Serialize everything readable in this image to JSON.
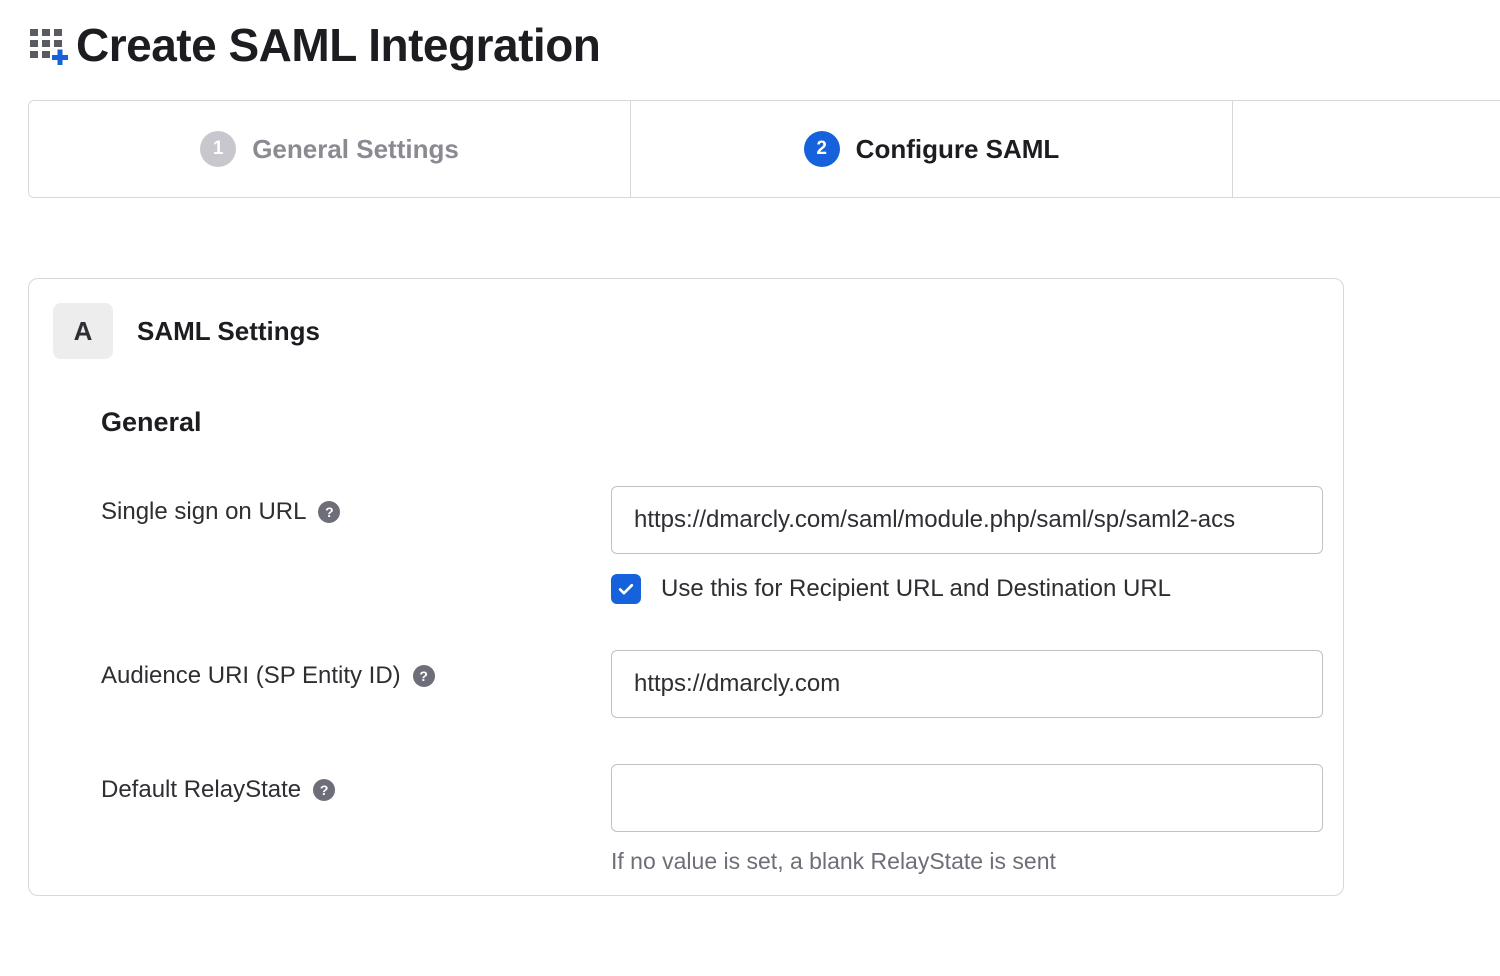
{
  "header": {
    "title": "Create SAML Integration"
  },
  "wizard": {
    "steps": [
      {
        "num": "1",
        "label": "General Settings",
        "state": "inactive"
      },
      {
        "num": "2",
        "label": "Configure SAML",
        "state": "active"
      }
    ]
  },
  "panel": {
    "section_badge": "A",
    "section_title": "SAML Settings",
    "subsection_title": "General",
    "fields": {
      "sso_url": {
        "label": "Single sign on URL",
        "value": "https://dmarcly.com/saml/module.php/saml/sp/saml2-acs",
        "checkbox_label": "Use this for Recipient URL and Destination URL",
        "checkbox_checked": true
      },
      "audience_uri": {
        "label": "Audience URI (SP Entity ID)",
        "value": "https://dmarcly.com"
      },
      "relay_state": {
        "label": "Default RelayState",
        "value": "",
        "help": "If no value is set, a blank RelayState is sent"
      }
    }
  }
}
